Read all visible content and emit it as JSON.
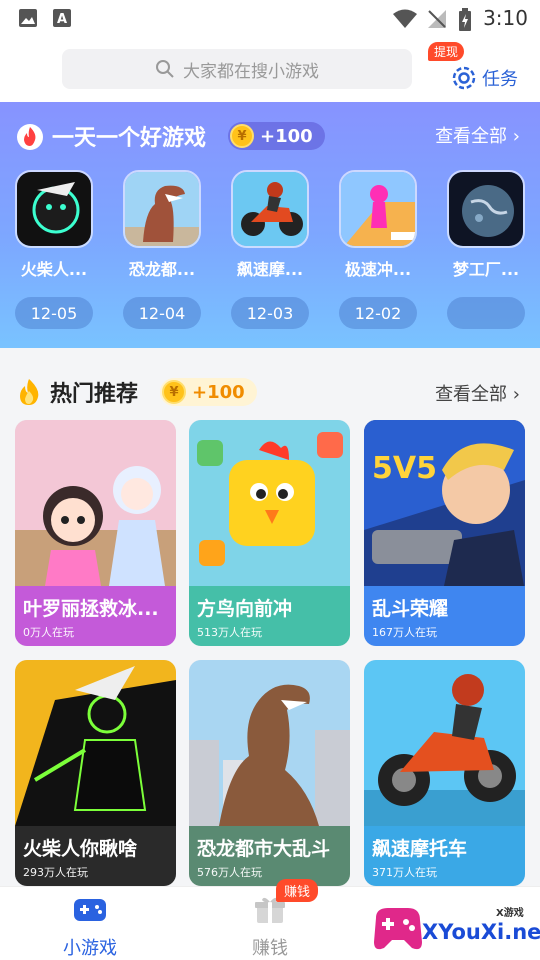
{
  "status_bar": {
    "time": "3:10"
  },
  "search": {
    "placeholder": "大家都在搜小游戏"
  },
  "task": {
    "label": "任务",
    "badge": "提现"
  },
  "daily": {
    "title": "一天一个好游戏",
    "coin_reward": "+100",
    "view_all": "查看全部",
    "games": [
      {
        "name": "火柴人...",
        "date": "12-05"
      },
      {
        "name": "恐龙都...",
        "date": "12-04"
      },
      {
        "name": "飙速摩...",
        "date": "12-03"
      },
      {
        "name": "极速冲...",
        "date": "12-02"
      },
      {
        "name": "梦工厂...",
        "date": ""
      }
    ]
  },
  "hot": {
    "title": "热门推荐",
    "coin_reward": "+100",
    "view_all": "查看全部",
    "cards": [
      {
        "title": "叶罗丽拯救冰...",
        "players": "0万人在玩",
        "color": "#c45ad9"
      },
      {
        "title": "方鸟向前冲",
        "players": "513万人在玩",
        "color": "#45bfa8"
      },
      {
        "title": "乱斗荣耀",
        "players": "167万人在玩",
        "color": "#3f86f0"
      },
      {
        "title": "火柴人你瞅啥",
        "players": "293万人在玩",
        "color": "#2a2a2a"
      },
      {
        "title": "恐龙都市大乱斗",
        "players": "576万人在玩",
        "color": "#5a8a72"
      },
      {
        "title": "飙速摩托车",
        "players": "371万人在玩",
        "color": "#3aa8e6"
      }
    ]
  },
  "bottom_nav": {
    "items": [
      {
        "label": "小游戏",
        "active": true
      },
      {
        "label": "赚钱",
        "active": false
      }
    ],
    "earn_badge": "赚钱"
  },
  "watermark": {
    "text": "XYouXi.net",
    "small": "X游戏"
  },
  "colors": {
    "accent": "#2b62d6",
    "active_tab": "#2a62e0"
  }
}
